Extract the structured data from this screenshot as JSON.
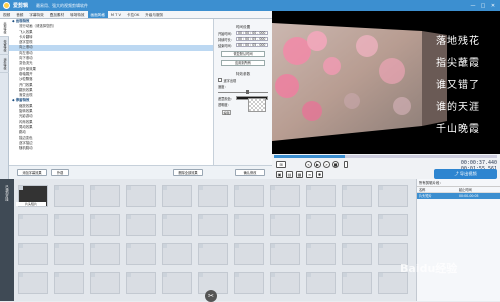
{
  "app": {
    "name": "爱剪辑",
    "subtitle": "最易用、强大的视频剪辑软件",
    "window_controls": [
      "—",
      "□",
      "✕"
    ]
  },
  "tabs": [
    "视频",
    "音频",
    "字幕特效",
    "叠加素材",
    "转场特效",
    "画面风格",
    "M T V",
    "卡拉OK",
    "升级与服务"
  ],
  "active_tab": 5,
  "vtabs": [
    "出现特效",
    "停留特效",
    "消失特效"
  ],
  "tree": [
    {
      "label": "◆ 出现特效",
      "group": true
    },
    {
      "label": "流行动画（请选择您的）"
    },
    {
      "label": "飞入效果"
    },
    {
      "label": "卡片翻转"
    },
    {
      "label": "逐字显现"
    },
    {
      "label": "向上滚动",
      "sel": true
    },
    {
      "label": "向左滚动"
    },
    {
      "label": "向下滚动"
    },
    {
      "label": "变色流光"
    },
    {
      "label": "百叶窗效果"
    },
    {
      "label": "卷轴展开"
    },
    {
      "label": "沙粒飘落"
    },
    {
      "label": "开门效果"
    },
    {
      "label": "翻页效果"
    },
    {
      "label": "渐变出现"
    },
    {
      "label": "◆ 停留特效",
      "group": true
    },
    {
      "label": "缩放效果"
    },
    {
      "label": "旋转效果"
    },
    {
      "label": "光影游动"
    },
    {
      "label": "闪烁效果"
    },
    {
      "label": "晃动效果"
    },
    {
      "label": "跳动"
    },
    {
      "label": "描边变色"
    },
    {
      "label": "逐字描边"
    },
    {
      "label": "随机跳动"
    }
  ],
  "settings": {
    "time_title": "时间设置",
    "start_label": "开始时间：",
    "start_value": "00 : 00 : 00 . 000",
    "dur_label": "持续时长：",
    "dur_value": "00 : 00 : 05 . 000",
    "end_label": "结束时间：",
    "end_value": "00 : 00 : 05 . 000",
    "btn_reset": "恢复默认时间",
    "btn_apply": "应用到所有",
    "effect_title": "特效参数",
    "check_label": "逐字出现",
    "speed_label": "速度：",
    "mask_label": "遮罩颜色：",
    "opacity_label": "透明度：",
    "op_button": "编辑",
    "speed_level": 0.55,
    "mask_color": "#1a1a1a"
  },
  "bottom": {
    "btn1": "添加字幕效果",
    "btn2": "外观",
    "btn3": "删除全部效果",
    "btn4": "确认修改"
  },
  "preview": {
    "poem": [
      "落地残花",
      "指尖蘸霞",
      "谁又错了",
      "谁的天涯",
      "千山晚霞"
    ]
  },
  "player": {
    "current": "00:00:37.440",
    "total": "00:01:55.561",
    "progress": 0.32
  },
  "export": {
    "label": "导出视频"
  },
  "side_label": "已添加片段",
  "first_clip_label": "片头短片",
  "right_panel": {
    "head": "所有剪辑片段：",
    "col1": "名称",
    "col2": "起止时间",
    "row_name": "片头短片",
    "row_time": "00:00-00:05"
  },
  "watermark": "Baidu经验"
}
